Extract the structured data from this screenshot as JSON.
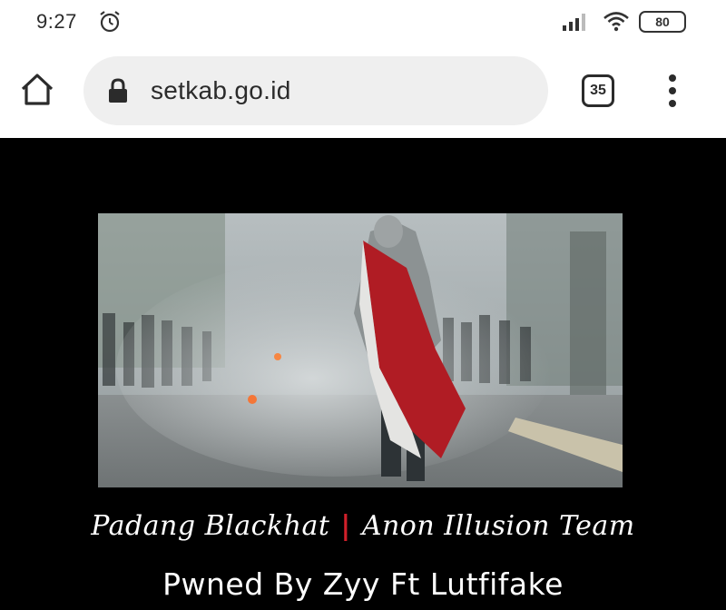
{
  "status_bar": {
    "time": "9:27",
    "battery": "80",
    "icons": [
      "alarm-icon",
      "signal-icon",
      "wifi-icon",
      "battery-icon"
    ]
  },
  "browser": {
    "url": "setkab.go.id",
    "tab_count": "35",
    "icons": [
      "home-icon",
      "lock-icon",
      "tabs-icon",
      "more-menu-icon"
    ]
  },
  "page": {
    "background": "#000000",
    "hero_image": "protester-with-red-white-flag-in-tear-gas-smoke",
    "credit_left": "Padang Blackhat",
    "separator": "|",
    "separator_color": "#d0202a",
    "credit_right": "Anon Illusion Team",
    "pwned": "Pwned By Zyy Ft Lutfifake"
  }
}
